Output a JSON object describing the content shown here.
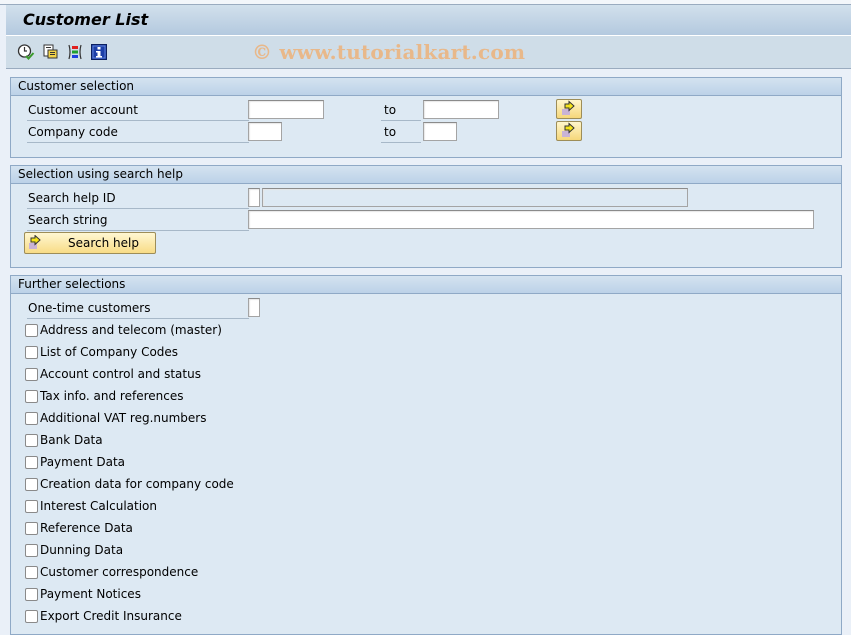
{
  "window": {
    "title": "Customer List"
  },
  "toolbar": {
    "icons": [
      {
        "name": "execute-icon",
        "tooltip": "Execute"
      },
      {
        "name": "get-variant-icon",
        "tooltip": "Get Variant"
      },
      {
        "name": "dynamic-selections-icon",
        "tooltip": "Dynamic Selections"
      },
      {
        "name": "program-documentation-icon",
        "tooltip": "Program Documentation"
      }
    ],
    "watermark": "© www.tutorialkart.com"
  },
  "customer_selection": {
    "header": "Customer selection",
    "rows": [
      {
        "label": "Customer account",
        "from_value": "",
        "to_label": "to",
        "to_value": ""
      },
      {
        "label": "Company code",
        "from_value": "",
        "to_label": "to",
        "to_value": ""
      }
    ]
  },
  "search_help_selection": {
    "header": "Selection using search help",
    "search_help_id_label": "Search help ID",
    "search_help_id_value": "",
    "search_help_id_desc": "",
    "search_string_label": "Search string",
    "search_string_value": "",
    "search_help_button": "Search help"
  },
  "further_selections": {
    "header": "Further selections",
    "one_time_label": "One-time customers",
    "one_time_value": "",
    "checkboxes": [
      {
        "label": "Address and telecom (master)",
        "checked": false
      },
      {
        "label": "List of Company Codes",
        "checked": false
      },
      {
        "label": "Account control and status",
        "checked": false
      },
      {
        "label": "Tax info. and references",
        "checked": false
      },
      {
        "label": "Additional VAT reg.numbers",
        "checked": false
      },
      {
        "label": "Bank Data",
        "checked": false
      },
      {
        "label": "Payment Data",
        "checked": false
      },
      {
        "label": "Creation data for company code",
        "checked": false
      },
      {
        "label": "Interest Calculation",
        "checked": false
      },
      {
        "label": "Reference Data",
        "checked": false
      },
      {
        "label": "Dunning Data",
        "checked": false
      },
      {
        "label": "Customer correspondence",
        "checked": false
      },
      {
        "label": "Payment Notices",
        "checked": false
      },
      {
        "label": "Export Credit Insurance",
        "checked": false
      }
    ]
  }
}
